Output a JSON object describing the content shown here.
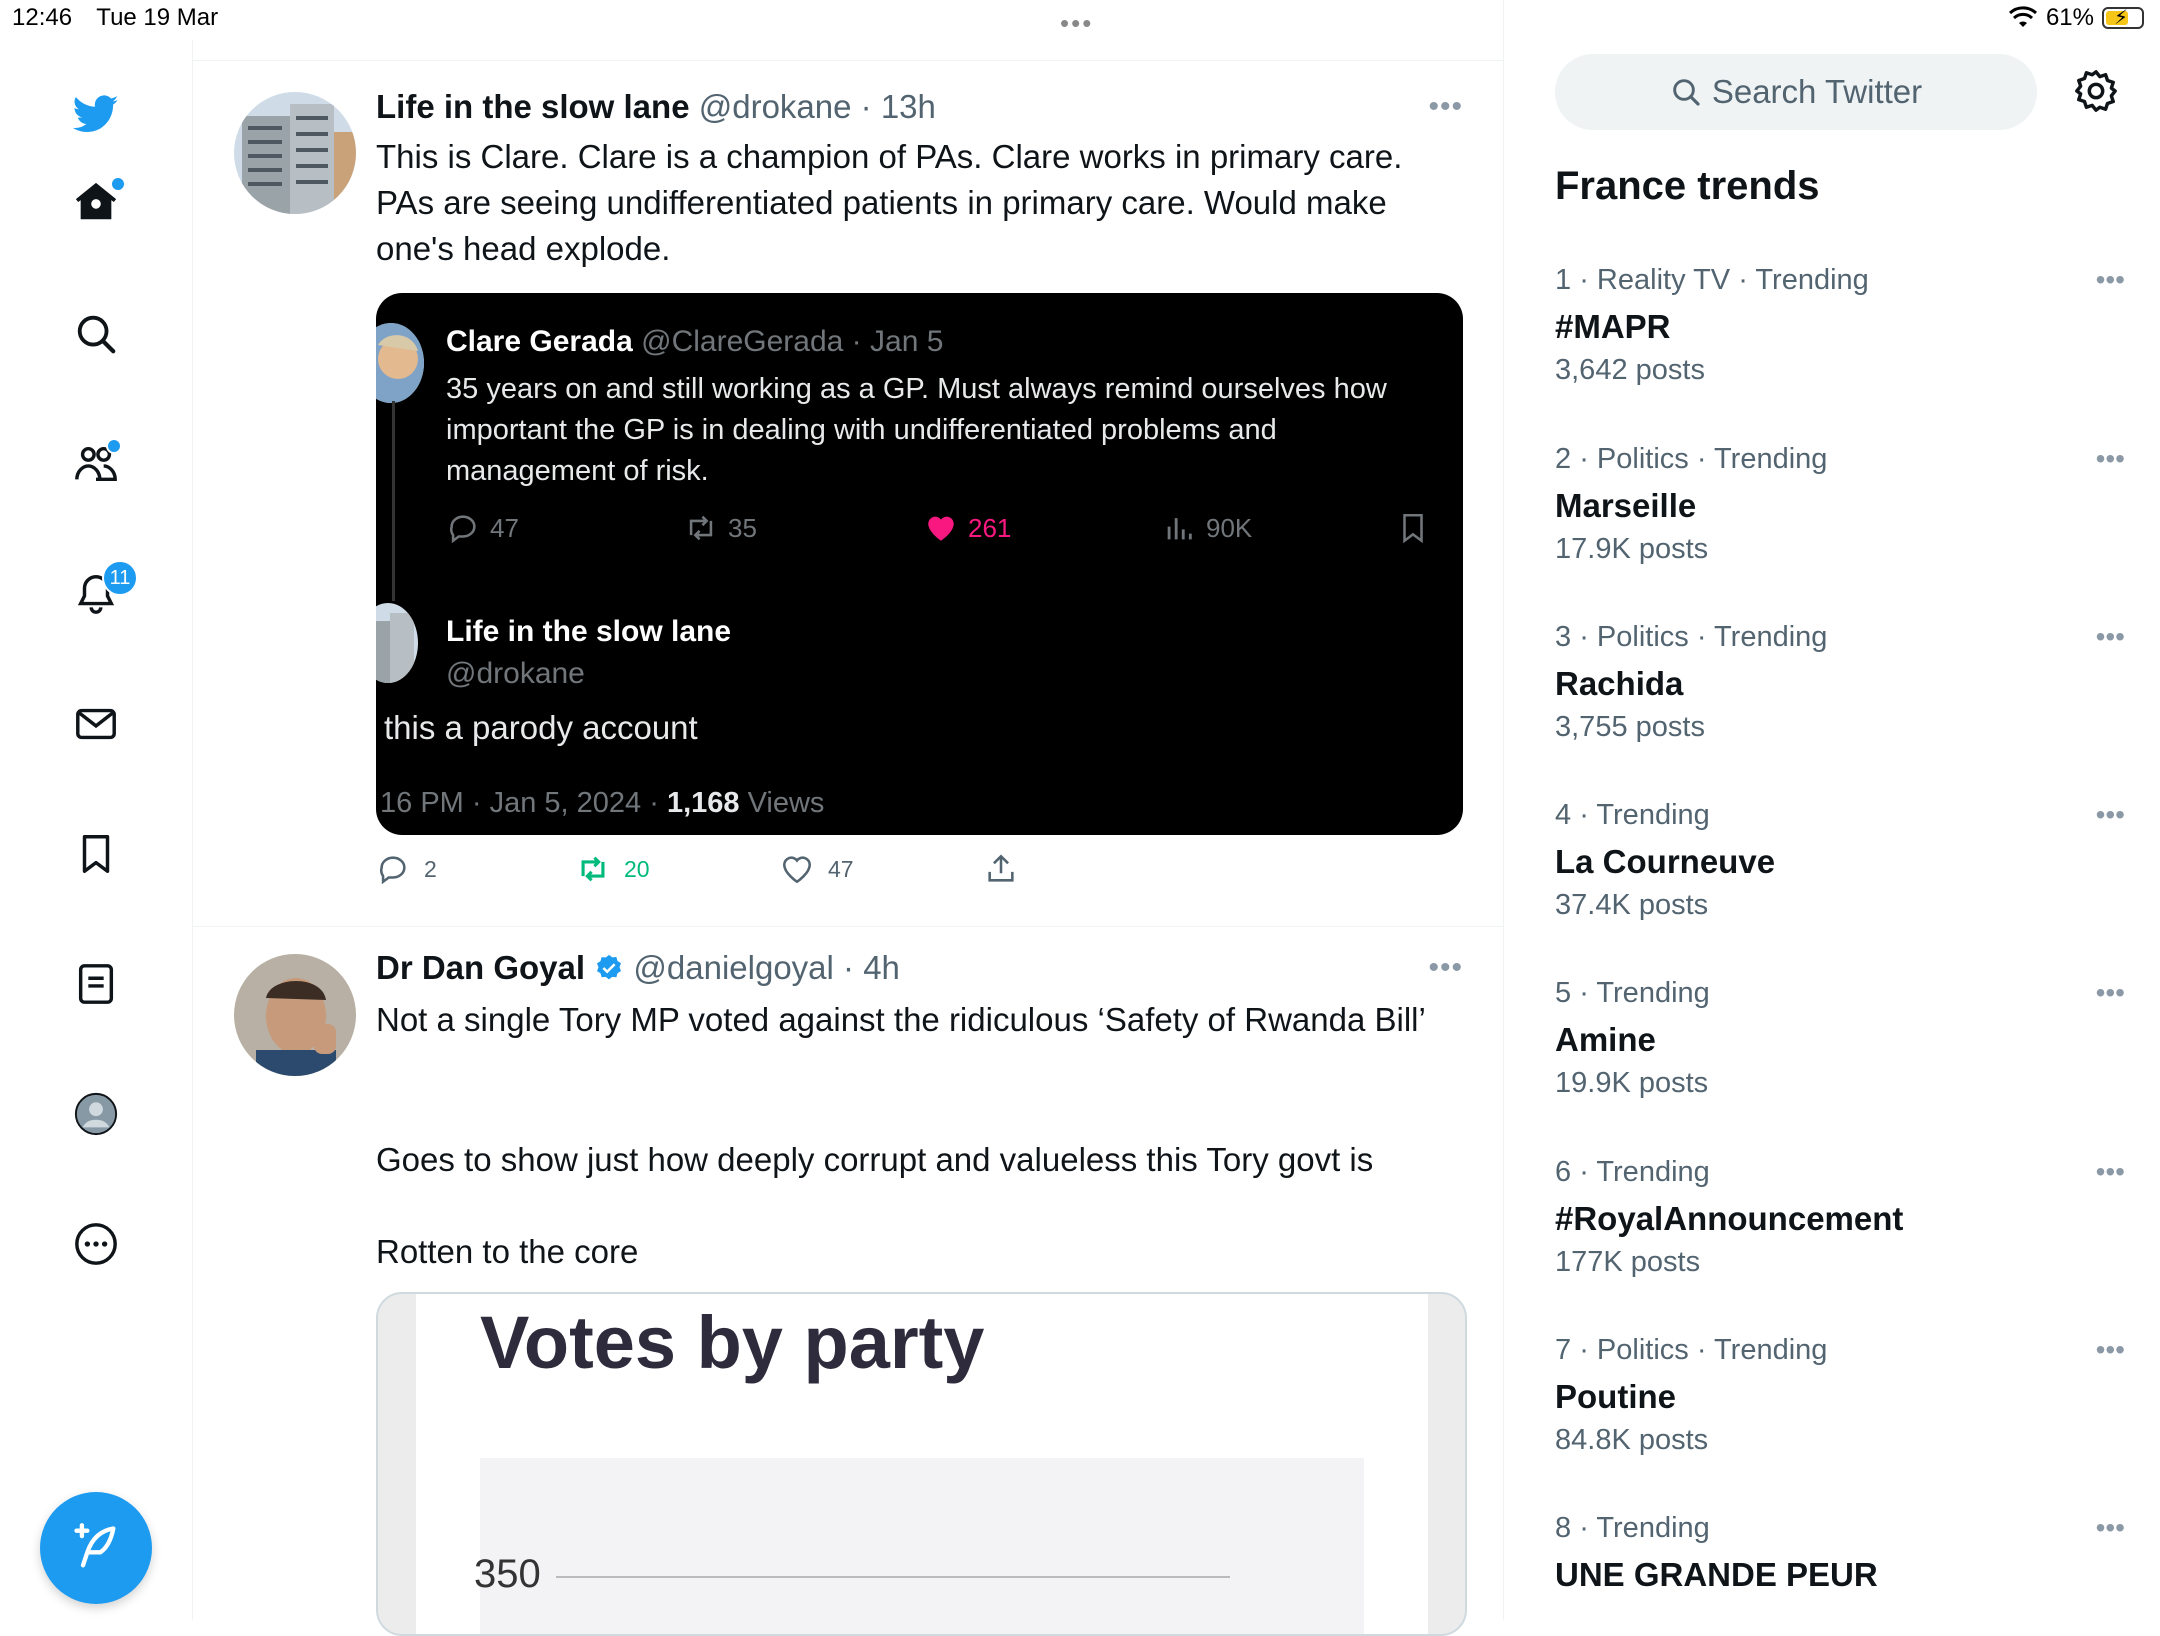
{
  "status_bar": {
    "time": "12:46",
    "date": "Tue 19 Mar",
    "battery": "61%"
  },
  "nav": {
    "notification_count": "11"
  },
  "tweets": [
    {
      "name": "Life in the slow lane",
      "handle": "@drokane",
      "time": "13h",
      "text": "This is Clare. Clare is a champion of PAs. Clare works in primary care. PAs are seeing undifferentiated patients in primary care. Would make one's head explode.",
      "embed": {
        "quoted_name": "Clare Gerada",
        "quoted_handle": "@ClareGerada",
        "quoted_date": "Jan 5",
        "quoted_text": "35 years on and still working as a GP. Must always remind ourselves how important the GP is in dealing with undifferentiated problems and management of risk.",
        "replies": "47",
        "retweets": "35",
        "likes": "261",
        "views": "90K",
        "reply_name": "Life in the slow lane",
        "reply_handle": "@drokane",
        "reply_text": "this a parody account",
        "reply_meta": "16 PM · Jan 5, 2024 · ",
        "reply_views_count": "1,168",
        "reply_views_label": " Views"
      },
      "replies": "2",
      "retweets": "20",
      "likes": "47"
    },
    {
      "name": "Dr Dan Goyal",
      "handle": "@danielgoyal",
      "time": "4h",
      "text_p1": "Not a single Tory MP voted against the ridiculous ‘Safety of Rwanda Bill’",
      "text_p2": "Goes to show just how deeply corrupt and valueless this Tory govt is",
      "text_p3": "Rotten to the core",
      "image": {
        "title": "Votes by party",
        "tick": "350"
      }
    }
  ],
  "sidebar": {
    "search_placeholder": "Search Twitter",
    "title": "France trends",
    "trends": [
      {
        "rank": "1",
        "category": "Reality TV · Trending",
        "name": "#MAPR",
        "posts": "3,642 posts"
      },
      {
        "rank": "2",
        "category": "Politics · Trending",
        "name": "Marseille",
        "posts": "17.9K posts"
      },
      {
        "rank": "3",
        "category": "Politics · Trending",
        "name": "Rachida",
        "posts": "3,755 posts"
      },
      {
        "rank": "4",
        "category": "Trending",
        "name": "La Courneuve",
        "posts": "37.4K posts"
      },
      {
        "rank": "5",
        "category": "Trending",
        "name": "Amine",
        "posts": "19.9K posts"
      },
      {
        "rank": "6",
        "category": "Trending",
        "name": "#RoyalAnnouncement",
        "posts": "177K posts"
      },
      {
        "rank": "7",
        "category": "Politics · Trending",
        "name": "Poutine",
        "posts": "84.8K posts"
      },
      {
        "rank": "8",
        "category": "Trending",
        "name": "UNE GRANDE PEUR",
        "posts": ""
      }
    ]
  },
  "colors": {
    "accent": "#1d9bf0",
    "retweet_green": "#00ba7c",
    "like_pink": "#f91880"
  }
}
